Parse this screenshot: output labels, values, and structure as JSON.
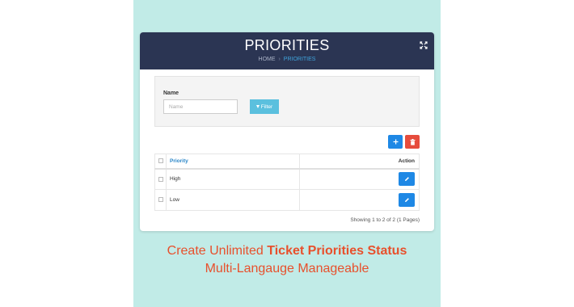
{
  "header": {
    "title": "PRIORITIES",
    "breadcrumb": {
      "home": "HOME",
      "separator": "›",
      "current": "PRIORITIES"
    }
  },
  "filter": {
    "label": "Name",
    "placeholder": "Name",
    "button_label": "Filter"
  },
  "table": {
    "columns": {
      "priority": "Priority",
      "action": "Action"
    },
    "rows": [
      {
        "priority": "High"
      },
      {
        "priority": "Low"
      }
    ]
  },
  "pagination": {
    "info": "Showing 1 to 2 of 2 (1 Pages)"
  },
  "caption": {
    "line1_prefix": "Create Unlimited ",
    "line1_bold": "Ticket Priorities Status",
    "line2": "Multi-Langauge Manageable"
  },
  "colors": {
    "background_panel": "#c1ebe7",
    "header_bg": "#2b3553",
    "accent_blue": "#1e88e5",
    "filter_button": "#5bc0de",
    "delete_red": "#e64c3c",
    "caption_orange": "#e8502c"
  },
  "icons": {
    "expand": "expand-icon",
    "filter": "funnel-icon",
    "add": "plus-icon",
    "delete": "trash-icon",
    "edit": "pencil-icon"
  }
}
